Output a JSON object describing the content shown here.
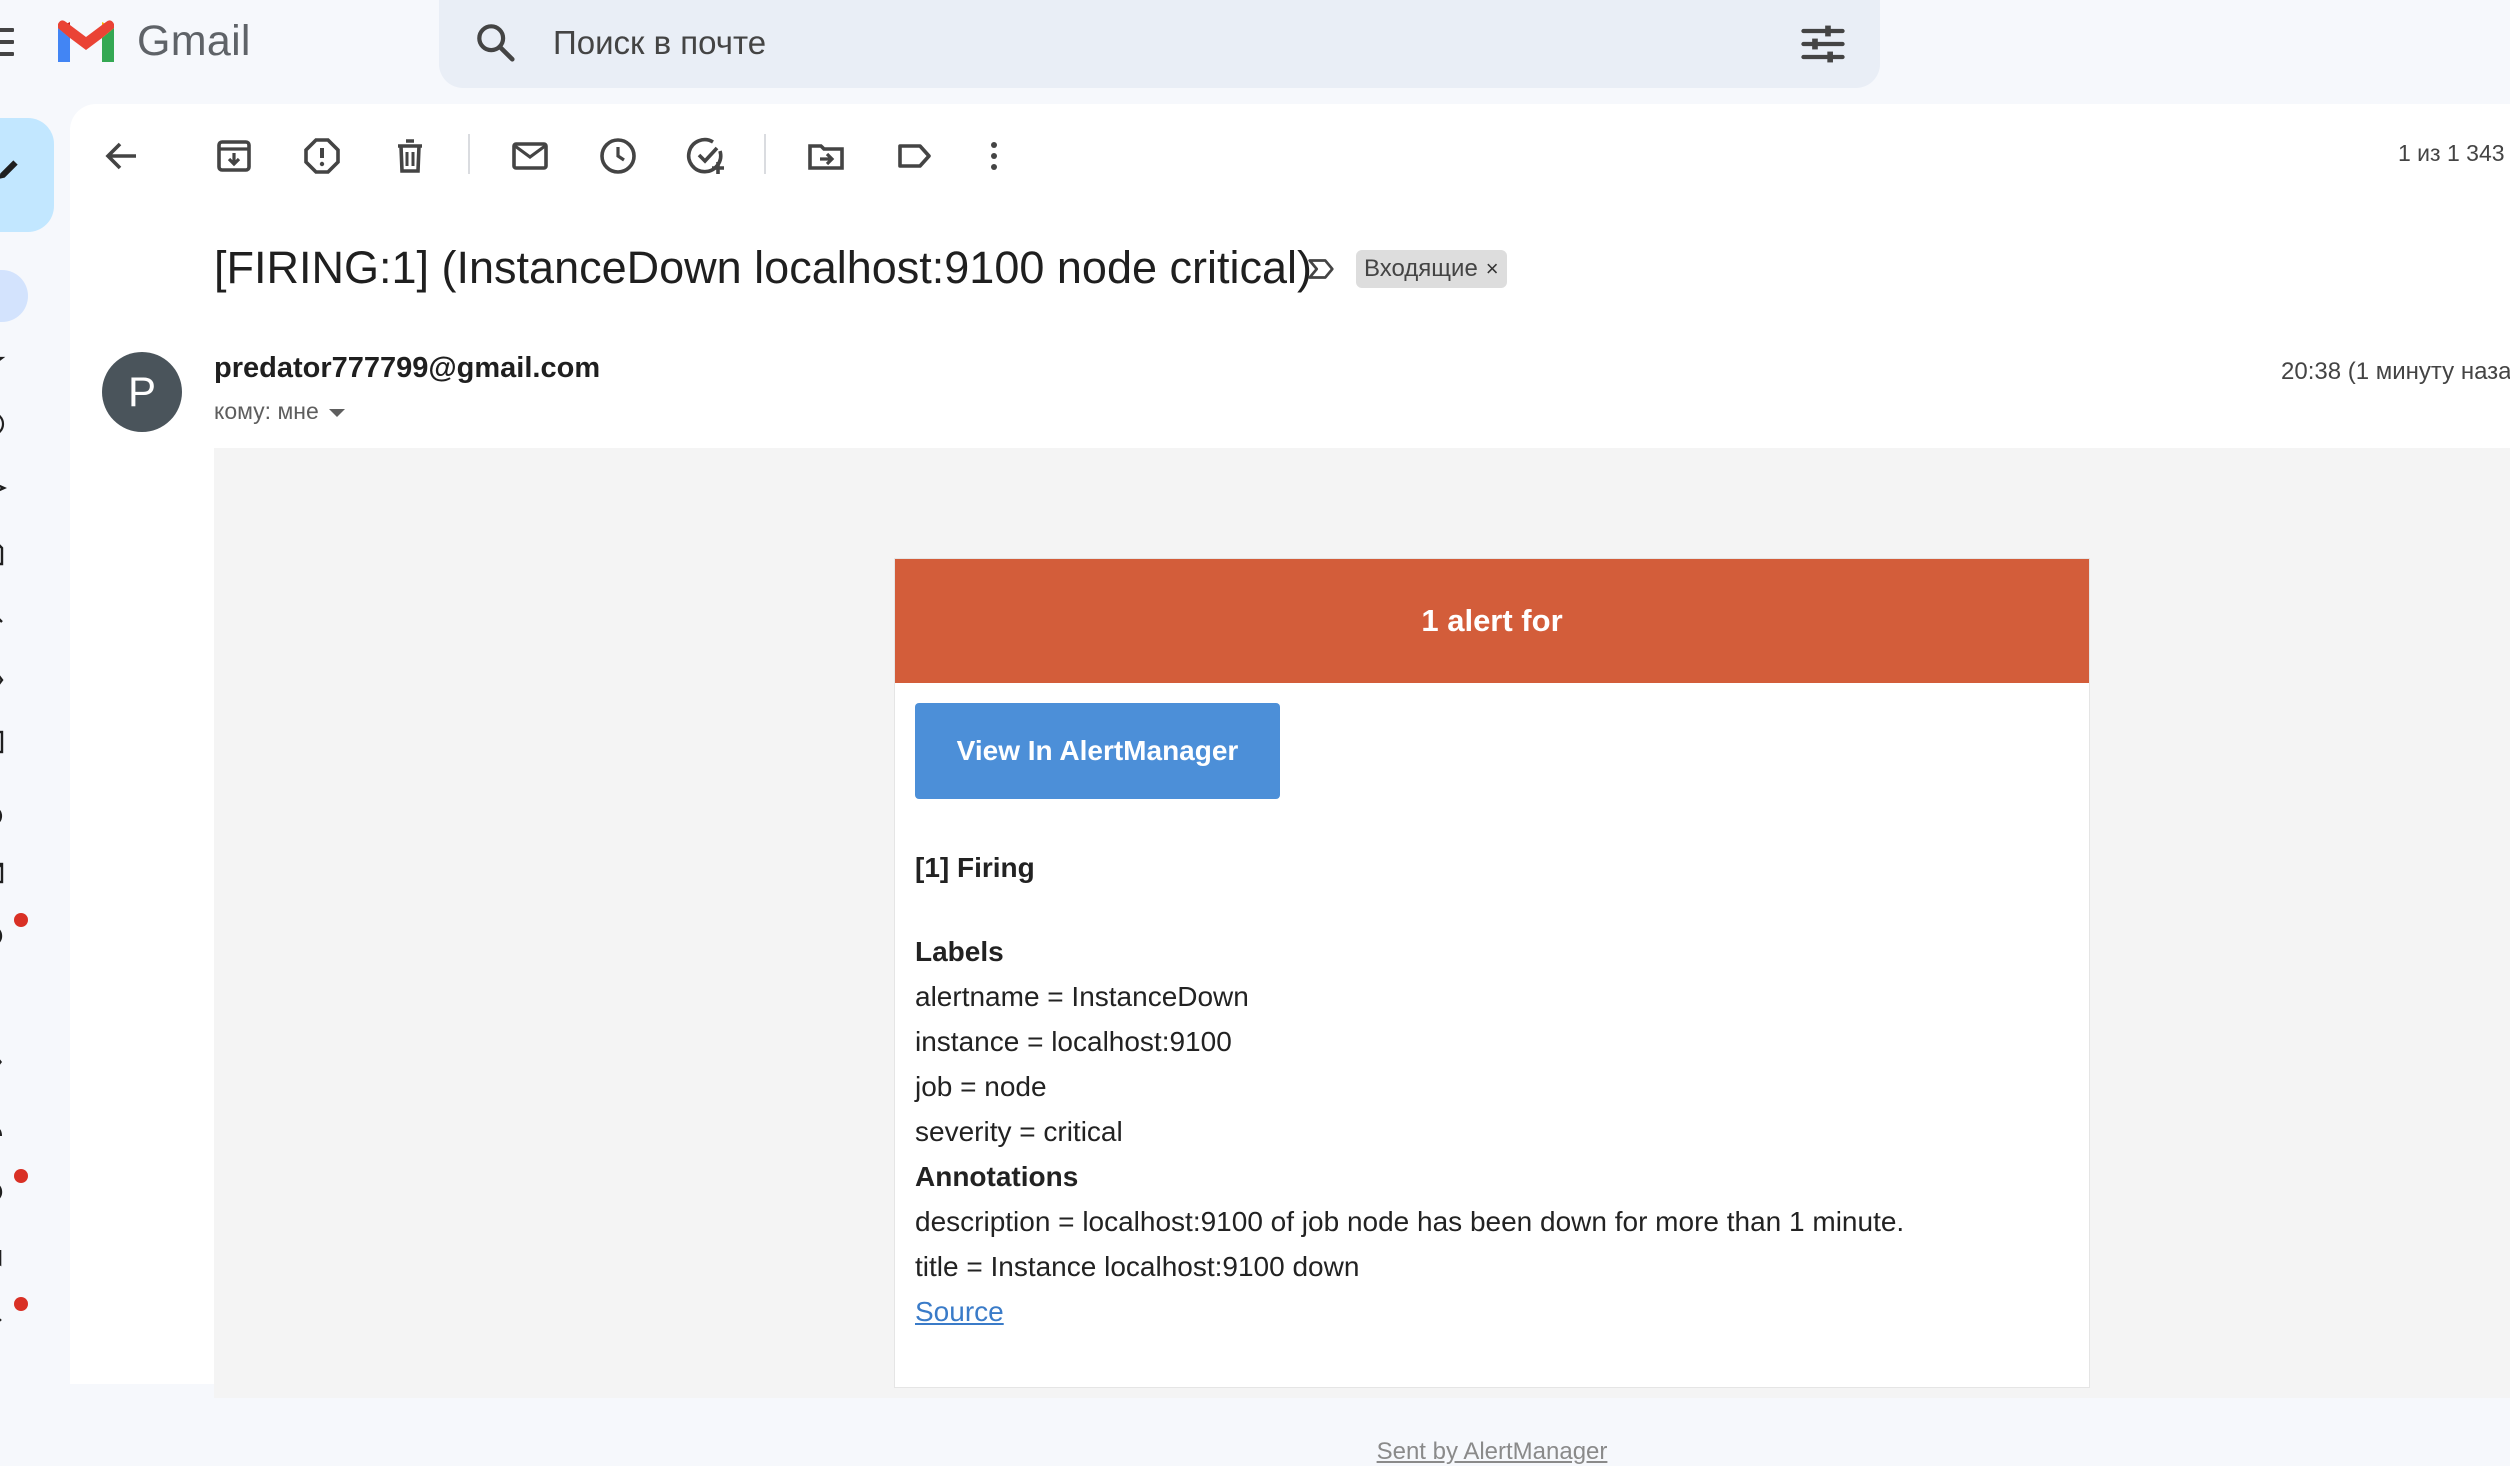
{
  "app": {
    "brand": "Gmail"
  },
  "search": {
    "placeholder": "Поиск в почте"
  },
  "toolbar": {
    "back": "back-icon",
    "archive": "archive-icon",
    "spam": "report-spam-icon",
    "delete": "trash-icon",
    "mark_unread": "mail-icon",
    "snooze": "clock-icon",
    "add_task": "add-task-icon",
    "move": "move-to-icon",
    "labels": "label-icon",
    "more": "more-vert-icon",
    "pager": "1 из 1 343"
  },
  "email": {
    "subject": "[FIRING:1] (InstanceDown localhost:9100 node critical)",
    "label_chip": "Входящие",
    "label_chip_close": "×",
    "avatar_letter": "P",
    "sender": "predator777799@gmail.com",
    "to": "кому: мне",
    "time": "20:38 (1 минуту наза"
  },
  "alert": {
    "header": "1 alert for",
    "button": "View In AlertManager",
    "firing": "[1] Firing",
    "labels_title": "Labels",
    "labels": [
      "alertname = InstanceDown",
      "instance = localhost:9100",
      "job = node",
      "severity = critical"
    ],
    "annotations_title": "Annotations",
    "annotations": [
      "description = localhost:9100 of job node has been down for more than 1 minute.",
      "title = Instance localhost:9100 down"
    ],
    "source_link": "Source",
    "footer": "Sent by AlertManager"
  },
  "colors": {
    "alert_header": "#d35d3a",
    "alert_button": "#4c8fd8",
    "compose": "#c2e7ff",
    "search_bg": "#e9eef6"
  }
}
